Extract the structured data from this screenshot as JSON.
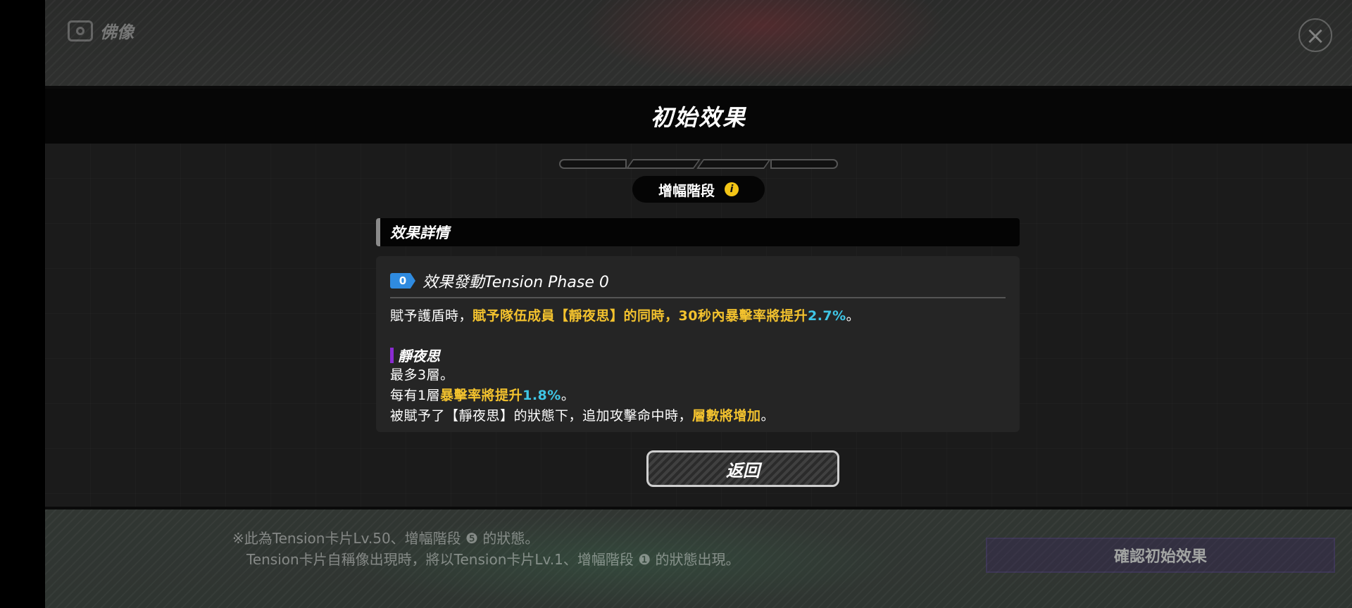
{
  "background": {
    "header_label": "佛像",
    "bottom_notes": [
      "※此為Tension卡片Lv.50、增幅階段 ❺ 的狀態。",
      "Tension卡片自稱像出現時，將以Tension卡片Lv.1、增幅階段 ❶ 的狀態出現。"
    ],
    "confirm_label": "確認初始效果",
    "close_glyph": "×"
  },
  "modal": {
    "title": "初始效果",
    "phase_segments": 4,
    "stage_label": "增幅階段",
    "info_glyph": "i",
    "section_title": "效果詳情",
    "phase_badge": "0",
    "phase_label": "效果發動Tension Phase 0",
    "effect_line": {
      "prefix": "賦予護盾時，",
      "highlight": "賦予隊伍成員【靜夜思】的同時，30秒內暴擊率將提升",
      "value": "2.7%",
      "suffix": "。"
    },
    "status_name": "靜夜思",
    "status_lines": {
      "max_stacks": "最多3層。",
      "per_stack_prefix": "每有1層",
      "per_stack_highlight": "暴擊率將提升",
      "per_stack_value": "1.8%",
      "per_stack_suffix": "。",
      "gain_prefix": "被賦予了【靜夜思】的狀態下，追加攻擊命中時，",
      "gain_highlight": "層數將增加",
      "gain_suffix": "。"
    },
    "return_label": "返回"
  },
  "colors": {
    "highlight_yellow": "#f3c22e",
    "highlight_cyan": "#3fc6e6",
    "status_purple": "#8a2bd2",
    "phase_badge_blue": "#2f8be0"
  }
}
